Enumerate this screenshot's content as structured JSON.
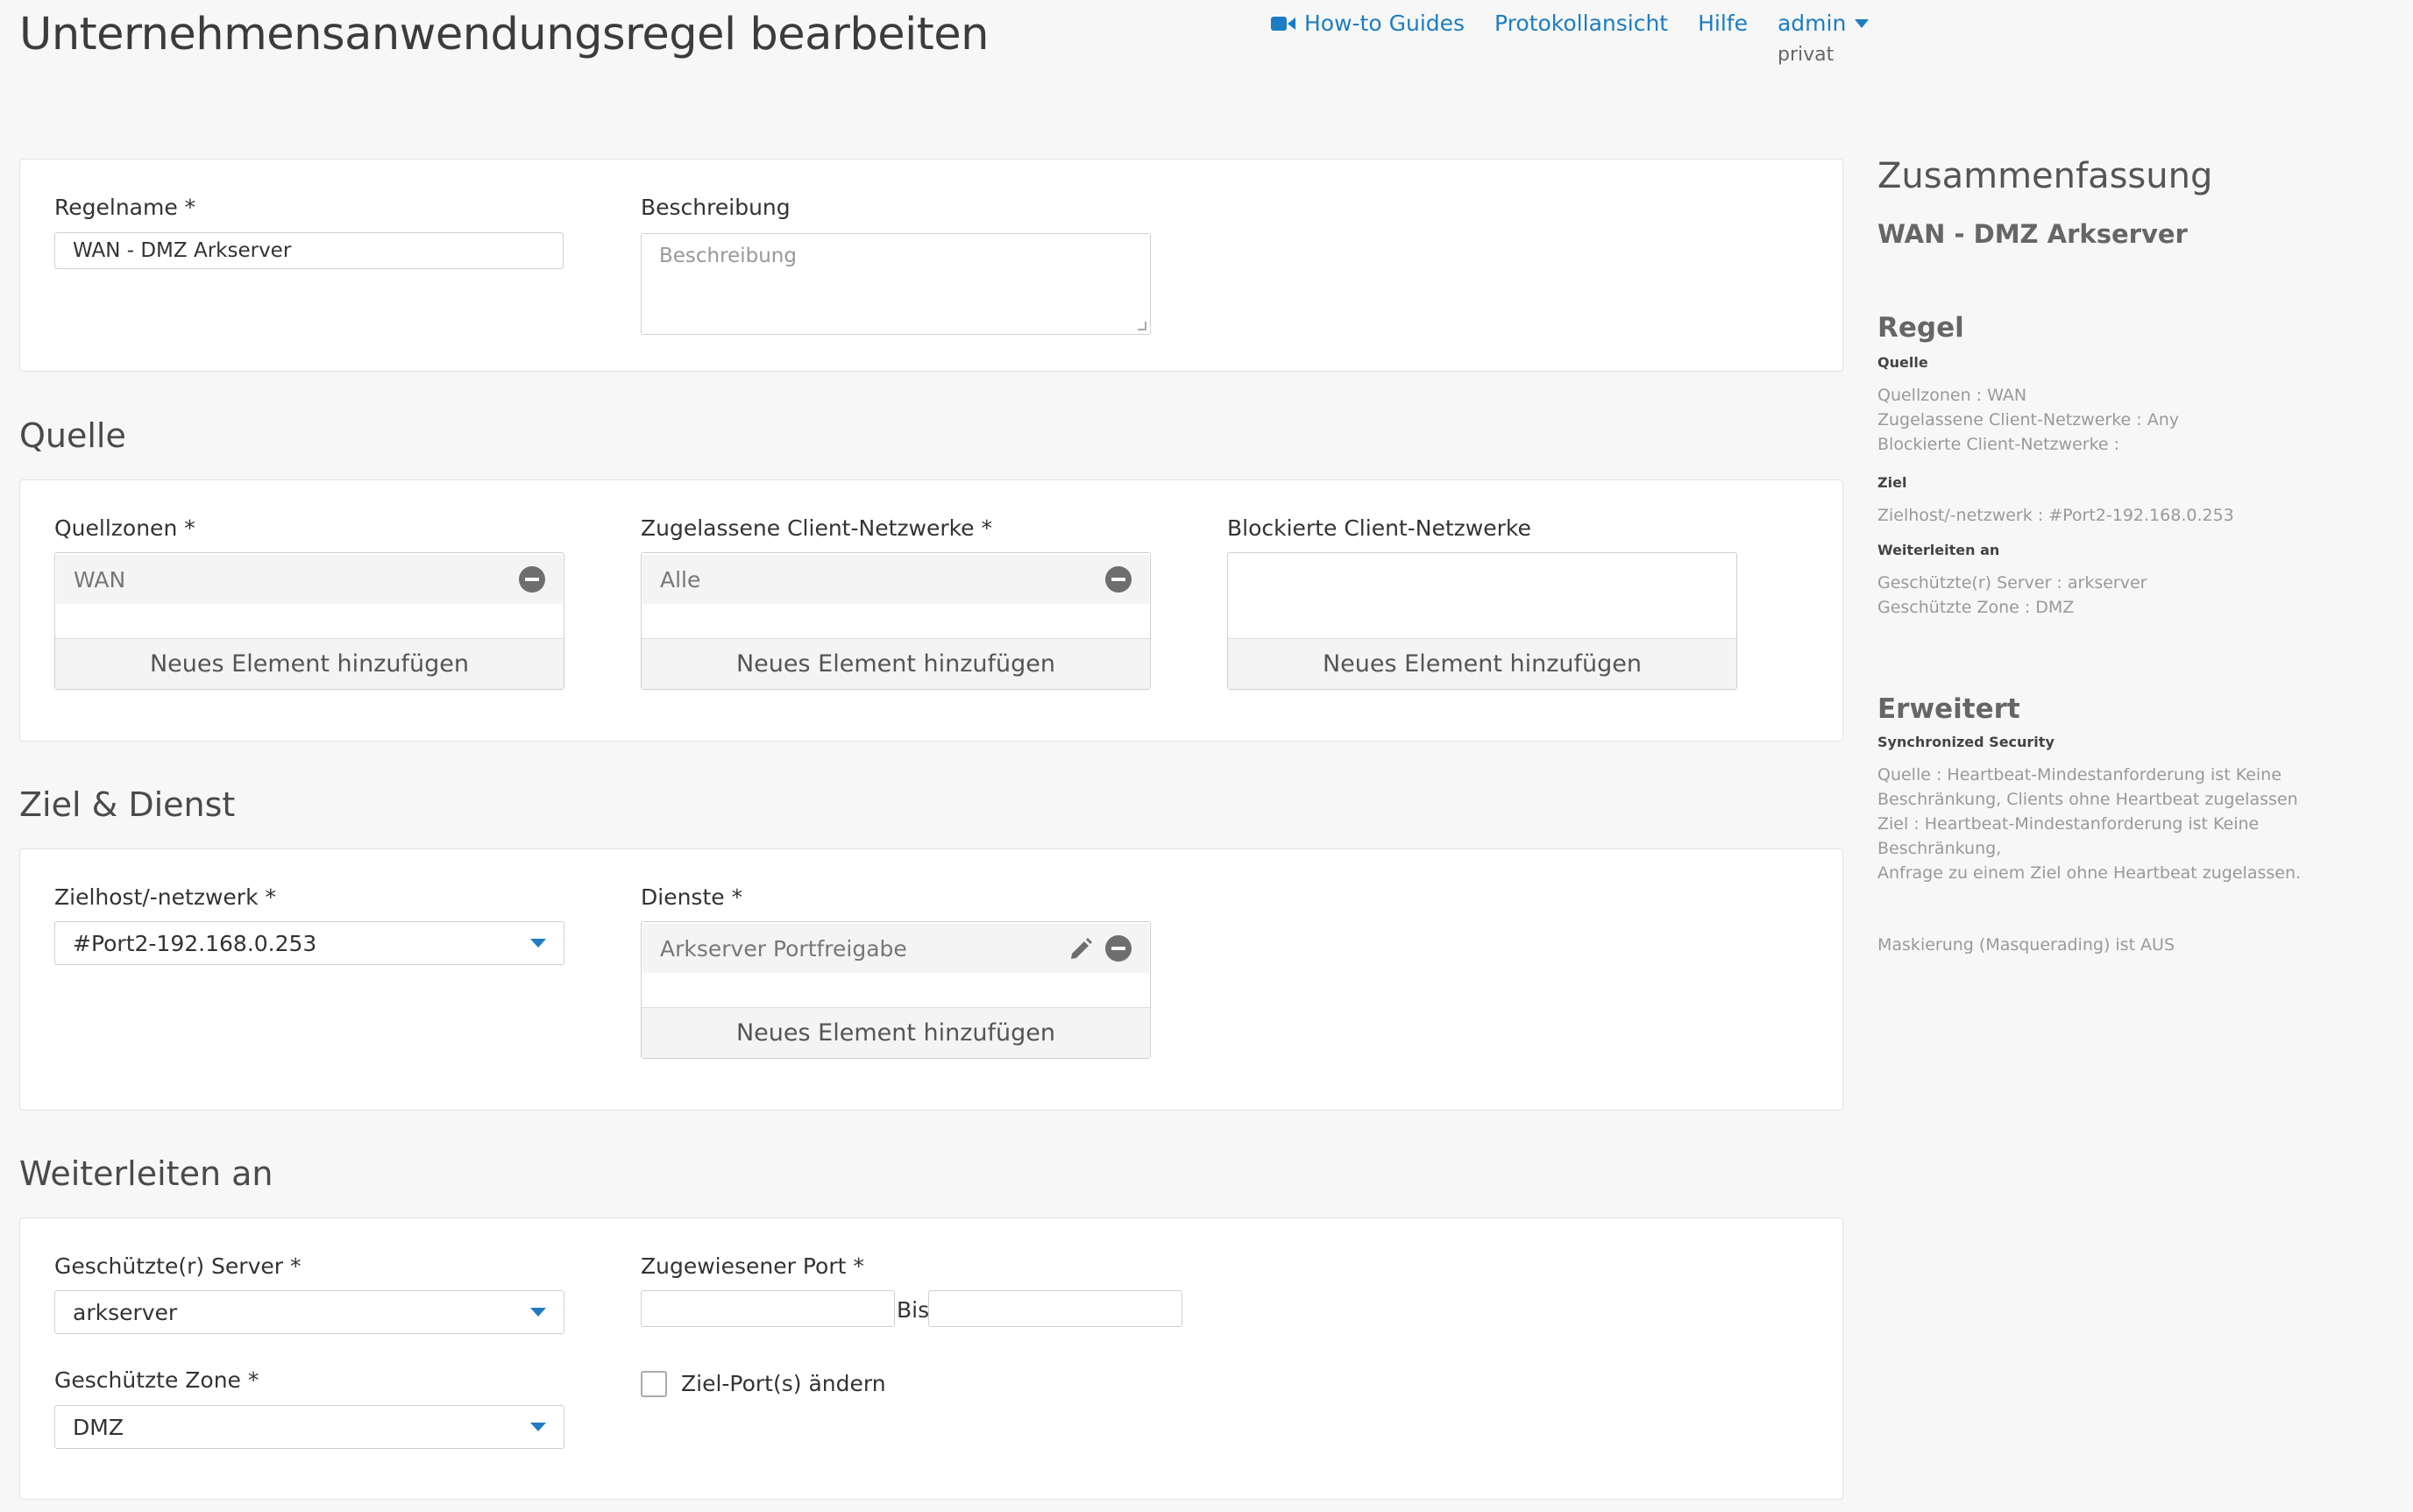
{
  "page": {
    "title": "Unternehmensanwendungsregel bearbeiten"
  },
  "topnav": {
    "howto": "How-to Guides",
    "log": "Protokollansicht",
    "help": "Hilfe",
    "user": "admin",
    "tenant": "privat"
  },
  "general": {
    "rule_name_label": "Regelname *",
    "rule_name_value": "WAN - DMZ Arkserver",
    "description_label": "Beschreibung",
    "description_placeholder": "Beschreibung"
  },
  "source": {
    "title": "Quelle",
    "zones_label": "Quellzonen *",
    "zones_items": [
      "WAN"
    ],
    "allowed_label": "Zugelassene Client-Netzwerke *",
    "allowed_items": [
      "Alle"
    ],
    "blocked_label": "Blockierte Client-Netzwerke",
    "add_label": "Neues Element hinzufügen"
  },
  "destination": {
    "title": "Ziel & Dienst",
    "host_label": "Zielhost/-netzwerk *",
    "host_value": "#Port2-192.168.0.253",
    "services_label": "Dienste *",
    "services_items": [
      "Arkserver Portfreigabe"
    ],
    "add_label": "Neues Element hinzufügen"
  },
  "forward": {
    "title": "Weiterleiten an",
    "server_label": "Geschützte(r) Server *",
    "server_value": "arkserver",
    "zone_label": "Geschützte Zone *",
    "zone_value": "DMZ",
    "port_label": "Zugewiesener Port *",
    "port_from": "",
    "port_to_label": "Bis",
    "port_to": "",
    "change_port_label": "Ziel-Port(s) ändern",
    "change_port_checked": false
  },
  "summary": {
    "title": "Zusammenfassung",
    "rule_name": "WAN - DMZ Arkserver",
    "regel_heading": "Regel",
    "quelle_sub": "Quelle",
    "quelle_lines": [
      "Quellzonen : WAN",
      "Zugelassene Client-Netzwerke : Any",
      "Blockierte Client-Netzwerke :"
    ],
    "ziel_sub": "Ziel",
    "ziel_lines": [
      "Zielhost/-netzwerk : #Port2-192.168.0.253"
    ],
    "weiter_sub": "Weiterleiten an",
    "weiter_lines": [
      "Geschützte(r) Server : arkserver",
      "Geschützte Zone : DMZ"
    ],
    "erweitert_heading": "Erweitert",
    "sync_sub": "Synchronized Security",
    "sync_lines": [
      "Quelle : Heartbeat-Mindestanforderung ist Keine",
      "Beschränkung, Clients ohne Heartbeat zugelassen",
      "Ziel : Heartbeat-Mindestanforderung ist Keine Beschränkung,",
      "Anfrage zu einem Ziel ohne Heartbeat zugelassen."
    ],
    "masq_line": "Maskierung (Masquerading) ist AUS"
  },
  "colors": {
    "link": "#1d7cc3",
    "background": "#f7f7f7",
    "card": "#ffffff"
  }
}
